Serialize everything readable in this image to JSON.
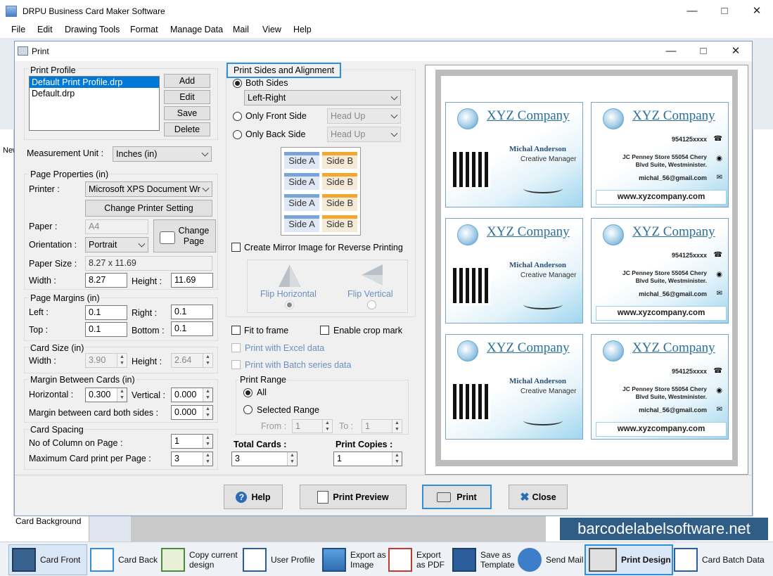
{
  "app": {
    "title": "DRPU Business Card Maker Software"
  },
  "menu": [
    "File",
    "Edit",
    "Drawing Tools",
    "Format",
    "Manage Data",
    "Mail",
    "View",
    "Help"
  ],
  "bg": {
    "new_label": "New",
    "card_background": "Card Background",
    "watermark": "barcodelabelsoftware.net"
  },
  "dialog": {
    "title": "Print",
    "profile": {
      "label": "Print Profile",
      "items": [
        "Default Print Profile.drp",
        "Default.drp"
      ],
      "selected": "Default Print Profile.drp",
      "add": "Add",
      "edit": "Edit",
      "save": "Save",
      "delete": "Delete"
    },
    "measurement": {
      "label": "Measurement Unit :",
      "value": "Inches (in)"
    },
    "page_props": {
      "label": "Page Properties (in)",
      "printer_label": "Printer :",
      "printer": "Microsoft XPS Document Wr",
      "change_printer": "Change Printer Setting",
      "paper_label": "Paper :",
      "paper": "A4",
      "change_page": "Change Page",
      "orientation_label": "Orientation :",
      "orientation": "Portrait",
      "paper_size_label": "Paper Size :",
      "paper_size": "8.27 x 11.69",
      "width_label": "Width :",
      "width": "8.27",
      "height_label": "Height :",
      "height": "11.69"
    },
    "margins": {
      "label": "Page Margins (in)",
      "left_label": "Left :",
      "left": "0.1",
      "right_label": "Right :",
      "right": "0.1",
      "top_label": "Top :",
      "top": "0.1",
      "bottom_label": "Bottom :",
      "bottom": "0.1"
    },
    "card_size": {
      "label": "Card Size (in)",
      "width_label": "Width :",
      "width": "3.90",
      "height_label": "Height :",
      "height": "2.64"
    },
    "between": {
      "label": "Margin Between Cards (in)",
      "h_label": "Horizontal :",
      "h": "0.300",
      "v_label": "Vertical :",
      "v": "0.000",
      "both_label": "Margin between card both sides :",
      "both": "0.000"
    },
    "spacing": {
      "label": "Card Spacing",
      "cols_label": "No of Column on Page :",
      "cols": "1",
      "max_label": "Maximum Card print per Page :",
      "max": "3"
    },
    "sides": {
      "label": "Print Sides and Alignment",
      "both": "Both Sides",
      "alignment": "Left-Right",
      "front": "Only Front Side",
      "back": "Only Back Side",
      "head_up_1": "Head Up",
      "head_up_2": "Head Up",
      "side_a": "Side A",
      "side_b": "Side B",
      "mirror": "Create Mirror Image for Reverse Printing",
      "flip_h": "Flip Horizontal",
      "flip_v": "Flip Vertical"
    },
    "fit": "Fit to frame",
    "crop": "Enable crop mark",
    "excel": "Print with Excel data",
    "batch": "Print with Batch series data",
    "range": {
      "label": "Print Range",
      "all": "All",
      "selected": "Selected Range",
      "from_label": "From :",
      "from": "1",
      "to_label": "To :",
      "to": "1"
    },
    "total_label": "Total Cards :",
    "total": "3",
    "copies_label": "Print Copies :",
    "copies": "1",
    "help": "Help",
    "preview": "Print Preview",
    "print": "Print",
    "close": "Close"
  },
  "card": {
    "company": "XYZ Company",
    "name": "Michal Anderson",
    "role": "Creative Manager",
    "phone": "954125xxxx",
    "address1": "JC Penney Store 55054 Chery",
    "address2": "Blvd Suite, Westminister.",
    "email": "michal_56@gmail.com",
    "web": "www.xyzcompany.com"
  },
  "toolbar": [
    "Card Front",
    "Card Back",
    "Copy current design",
    "User Profile",
    "Export as Image",
    "Export as PDF",
    "Save as Template",
    "Send Mail",
    "Print Design",
    "Card Batch Data"
  ],
  "colors": {
    "accent": "#2f8fd8",
    "card_blue": "#2a6f9c"
  }
}
